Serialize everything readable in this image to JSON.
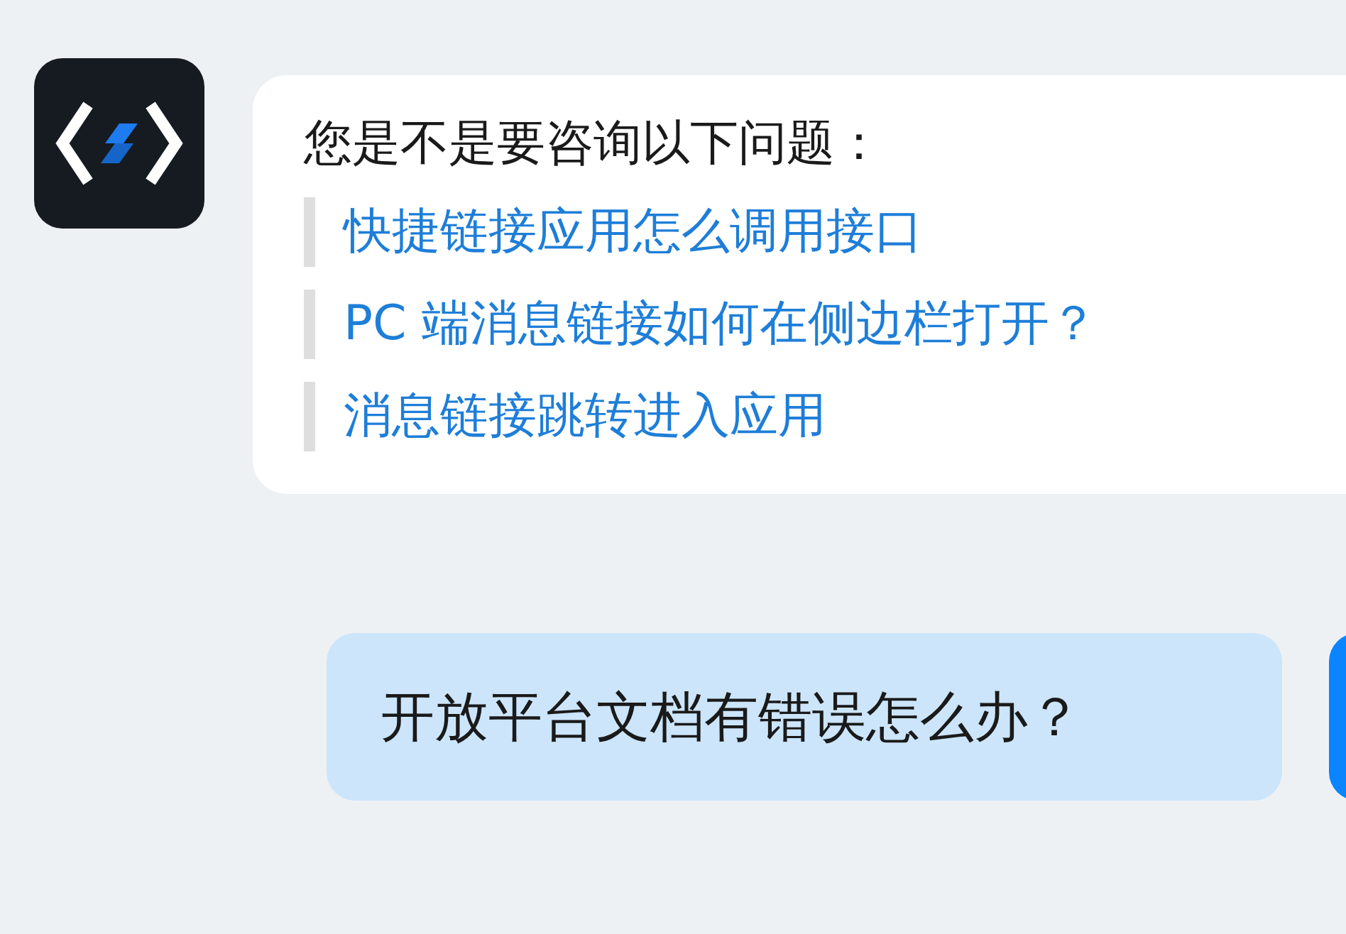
{
  "messages": [
    {
      "kind": "bot",
      "title": "您是不是要咨询以下问题：",
      "suggestions": [
        "快捷链接应用怎么调用接口",
        "PC 端消息链接如何在侧边栏打开？",
        "消息链接跳转进入应用"
      ]
    },
    {
      "kind": "user",
      "text": "开放平台文档有错误怎么办？"
    }
  ]
}
